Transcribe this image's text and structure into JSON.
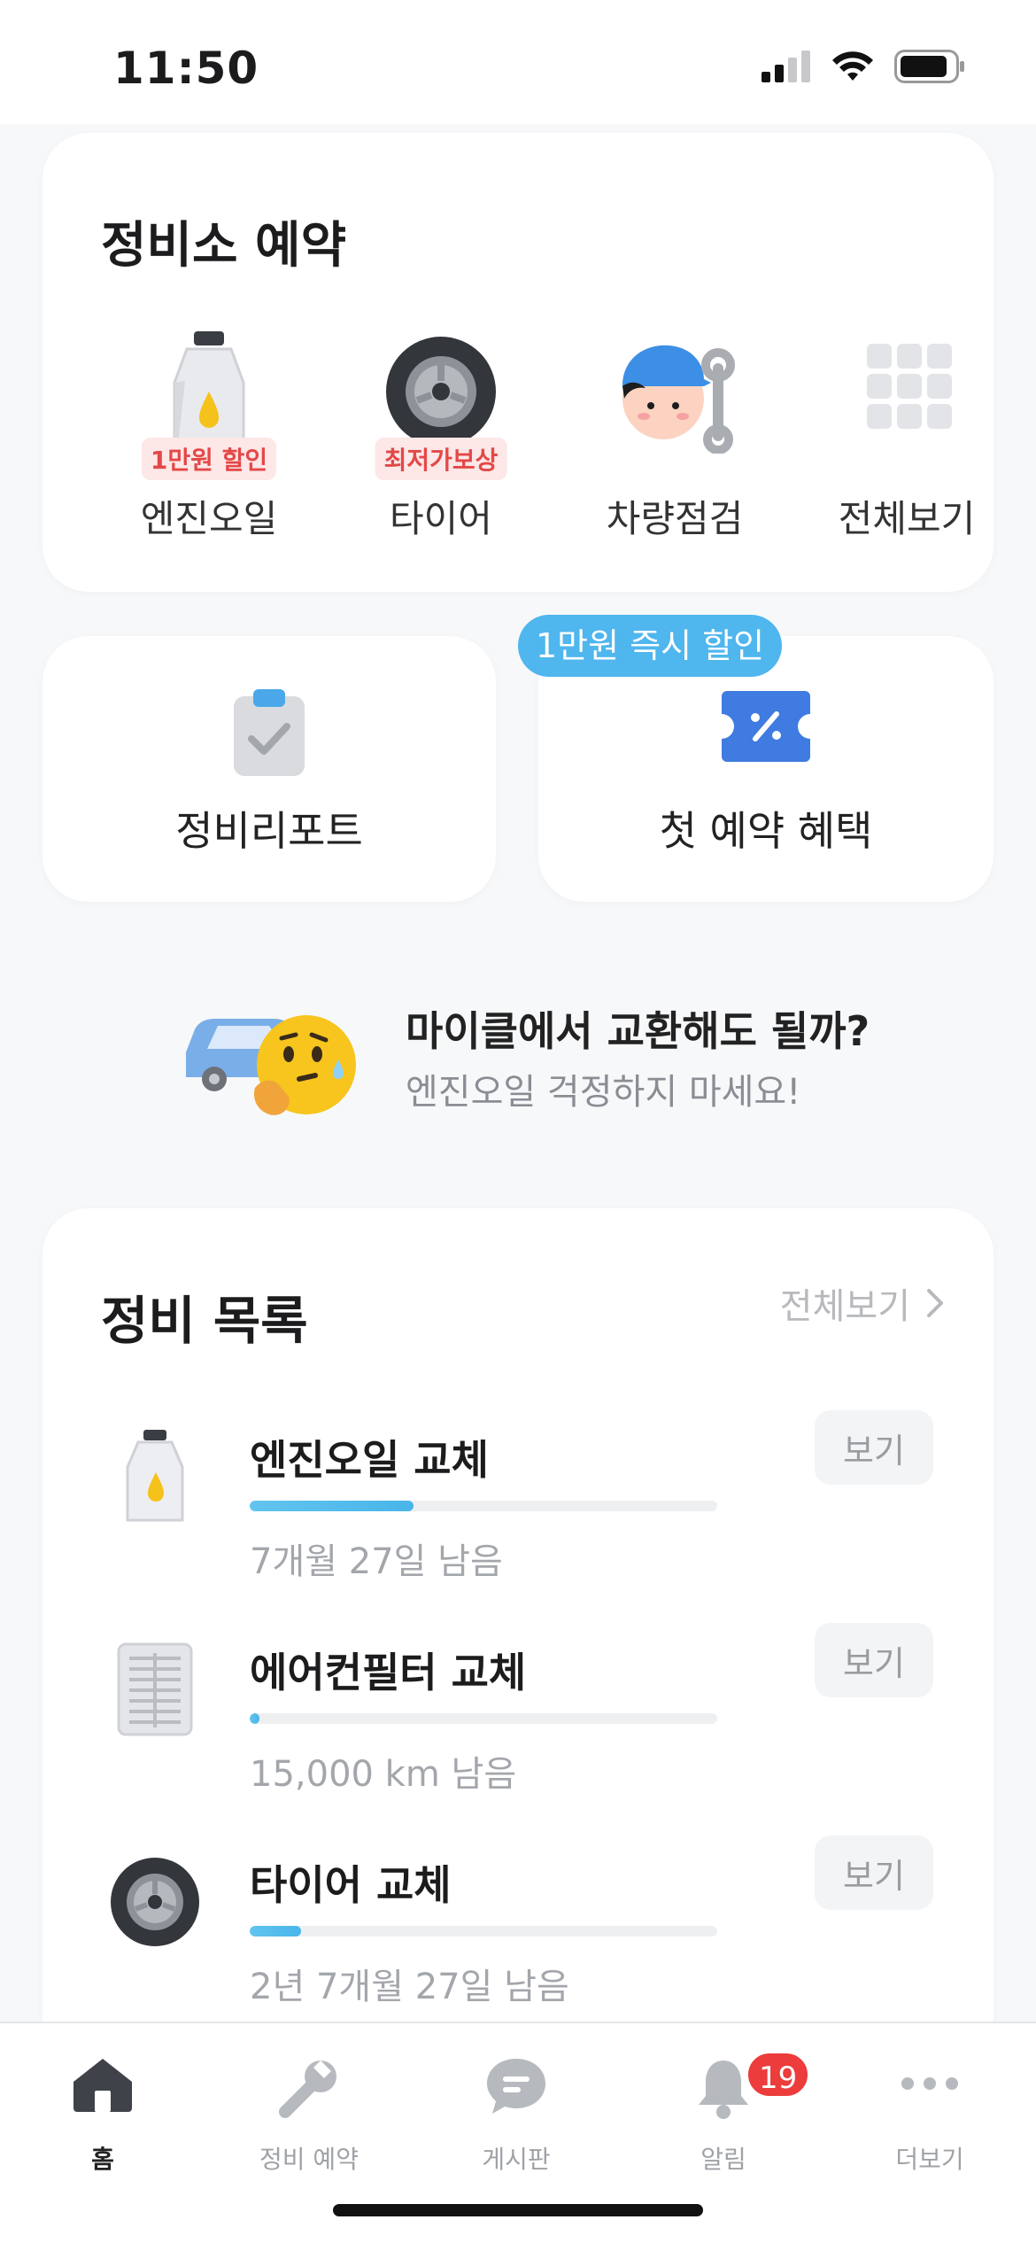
{
  "status_bar": {
    "time": "11:50"
  },
  "booking_card": {
    "title": "정비소 예약",
    "items": [
      {
        "label": "엔진오일",
        "badge": "1만원 할인",
        "icon": "engine-oil-icon"
      },
      {
        "label": "타이어",
        "badge": "최저가보상",
        "icon": "tire-icon"
      },
      {
        "label": "차량점검",
        "badge": "",
        "icon": "mechanic-icon"
      },
      {
        "label": "전체보기",
        "badge": "",
        "icon": "grid-icon"
      }
    ]
  },
  "quick_cards": {
    "report_label": "정비리포트",
    "benefit_label": "첫 예약 혜택",
    "benefit_pill": "1만원 즉시 할인"
  },
  "promo": {
    "title": "마이클에서 교환해도 될까?",
    "subtitle": "엔진오일 걱정하지 마세요!"
  },
  "maintenance": {
    "title": "정비 목록",
    "view_all": "전체보기",
    "items": [
      {
        "name": "엔진오일 교체",
        "remaining": "7개월 27일 남음",
        "progress": 0.35,
        "button": "보기",
        "icon": "engine-oil-icon"
      },
      {
        "name": "에어컨필터 교체",
        "remaining": "15,000 km 남음",
        "progress": 0.02,
        "button": "보기",
        "icon": "air-filter-icon"
      },
      {
        "name": "타이어 교체",
        "remaining": "2년 7개월 27일 남음",
        "progress": 0.11,
        "button": "보기",
        "icon": "tire-icon"
      }
    ]
  },
  "tab_bar": {
    "tabs": [
      {
        "label": "홈",
        "icon": "home-icon",
        "active": true
      },
      {
        "label": "정비 예약",
        "icon": "wrench-icon",
        "active": false
      },
      {
        "label": "게시판",
        "icon": "chat-icon",
        "active": false
      },
      {
        "label": "알림",
        "icon": "bell-icon",
        "active": false,
        "badge": "19"
      },
      {
        "label": "더보기",
        "icon": "more-icon",
        "active": false
      }
    ]
  },
  "colors": {
    "accent": "#4fb6ee",
    "badge_red": "#ec3c3c",
    "benefit_icon": "#3f7be0"
  }
}
